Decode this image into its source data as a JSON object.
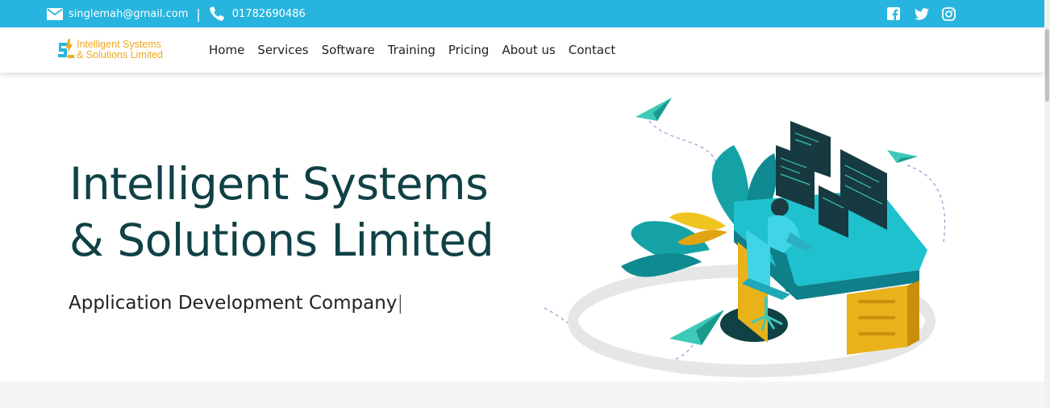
{
  "topbar": {
    "email": "singlemah@gmail.com",
    "separator": "|",
    "phone": "01782690486",
    "social_icons": [
      "facebook-icon",
      "twitter-icon",
      "instagram-icon"
    ]
  },
  "logo": {
    "line1": "Intelligent Systems",
    "line2": "& Solutions Limited"
  },
  "nav": {
    "items": [
      "Home",
      "Services",
      "Software",
      "Training",
      "Pricing",
      "About us",
      "Contact"
    ]
  },
  "hero": {
    "title_line1": "Intelligent Systems",
    "title_line2": "& Solutions Limited",
    "subtitle": "Application Development Company",
    "cursor": "|"
  },
  "colors": {
    "topbar": "#27b5df",
    "title": "#0f4145",
    "logo_text": "#f0a81a"
  }
}
